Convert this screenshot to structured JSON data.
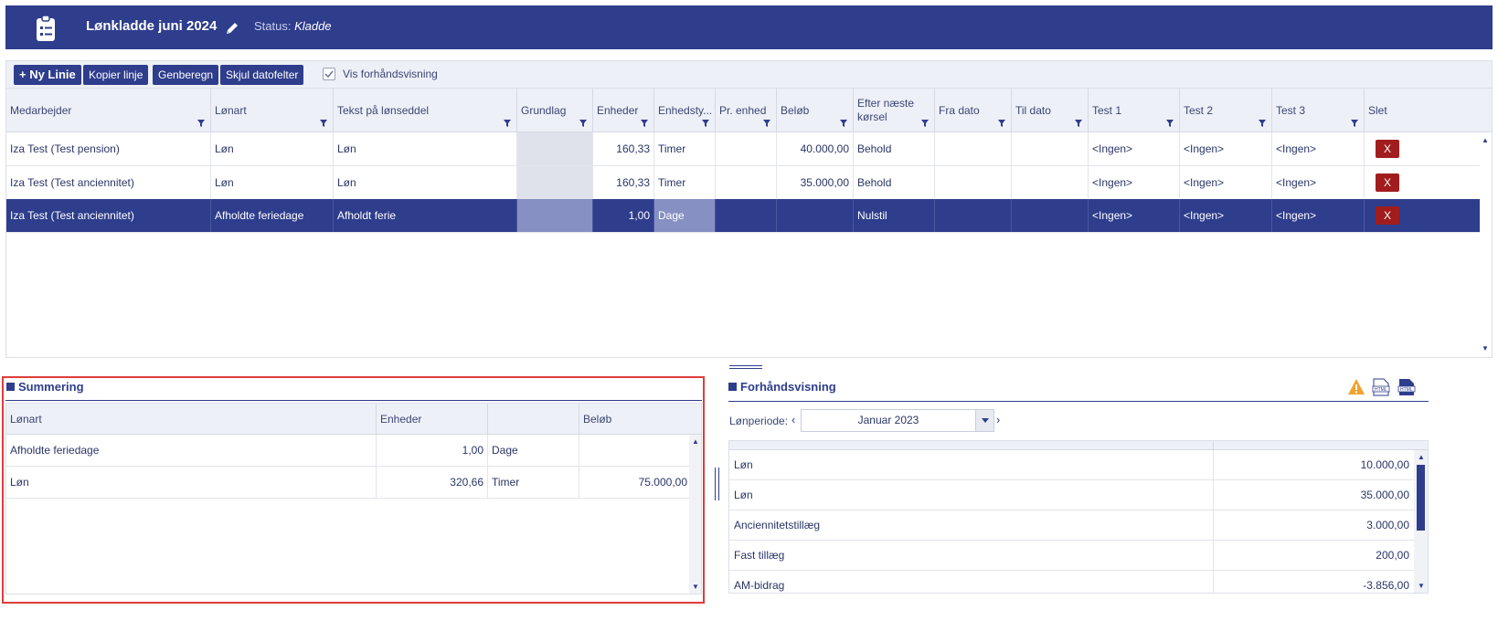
{
  "header": {
    "title": "Lønkladde juni 2024",
    "status_label": "Status:",
    "status_value": "Kladde",
    "icon": "clipboard-list-icon",
    "edit_icon": "pencil-icon"
  },
  "toolbar": {
    "new_line": "+ Ny Linie",
    "copy_line": "Kopier linje",
    "recalc": "Genberegn",
    "hide_dates": "Skjul datofelter",
    "preview_checkbox_label": "Vis forhåndsvisning",
    "preview_checked": true
  },
  "grid": {
    "columns": [
      "Medarbejder",
      "Lønart",
      "Tekst på lønseddel",
      "Grundlag",
      "Enheder",
      "Enhedsty...",
      "Pr. enhed",
      "Beløb",
      "Efter næste kørsel",
      "Fra dato",
      "Til dato",
      "Test 1",
      "Test 2",
      "Test 3",
      "Slet"
    ],
    "rows": [
      {
        "employee": "Iza Test (Test pension)",
        "wage_type": "Løn",
        "text": "Løn",
        "basis": "",
        "units": "160,33",
        "unit_type": "Timer",
        "per_unit": "",
        "amount": "40.000,00",
        "after_next": "Behold",
        "from": "",
        "to": "",
        "test1": "<Ingen>",
        "test2": "<Ingen>",
        "test3": "<Ingen>",
        "delete": "X",
        "selected": false
      },
      {
        "employee": "Iza Test (Test anciennitet)",
        "wage_type": "Løn",
        "text": "Løn",
        "basis": "",
        "units": "160,33",
        "unit_type": "Timer",
        "per_unit": "",
        "amount": "35.000,00",
        "after_next": "Behold",
        "from": "",
        "to": "",
        "test1": "<Ingen>",
        "test2": "<Ingen>",
        "test3": "<Ingen>",
        "delete": "X",
        "selected": false
      },
      {
        "employee": "Iza Test (Test anciennitet)",
        "wage_type": "Afholdte feriedage",
        "text": "Afholdt ferie",
        "basis": "",
        "units": "1,00",
        "unit_type": "Dage",
        "per_unit": "",
        "amount": "",
        "after_next": "Nulstil",
        "from": "",
        "to": "",
        "test1": "<Ingen>",
        "test2": "<Ingen>",
        "test3": "<Ingen>",
        "delete": "X",
        "selected": true
      }
    ]
  },
  "summary": {
    "title": "Summering",
    "columns": [
      "Lønart",
      "Enheder",
      "",
      "Beløb"
    ],
    "rows": [
      {
        "wage_type": "Afholdte feriedage",
        "units": "1,00",
        "unit_type": "Dage",
        "amount": ""
      },
      {
        "wage_type": "Løn",
        "units": "320,66",
        "unit_type": "Timer",
        "amount": "75.000,00"
      }
    ]
  },
  "preview": {
    "title": "Forhåndsvisning",
    "period_label": "Lønperiode:",
    "period_value": "Januar 2023",
    "icons": [
      "warning-icon",
      "html-file-icon",
      "html-export-icon"
    ],
    "rows": [
      {
        "label": "Løn",
        "amount": "10.000,00"
      },
      {
        "label": "Løn",
        "amount": "35.000,00"
      },
      {
        "label": "Anciennitetstillæg",
        "amount": "3.000,00"
      },
      {
        "label": "Fast tillæg",
        "amount": "200,00"
      },
      {
        "label": "AM-bidrag",
        "amount": "-3.856,00"
      }
    ]
  }
}
